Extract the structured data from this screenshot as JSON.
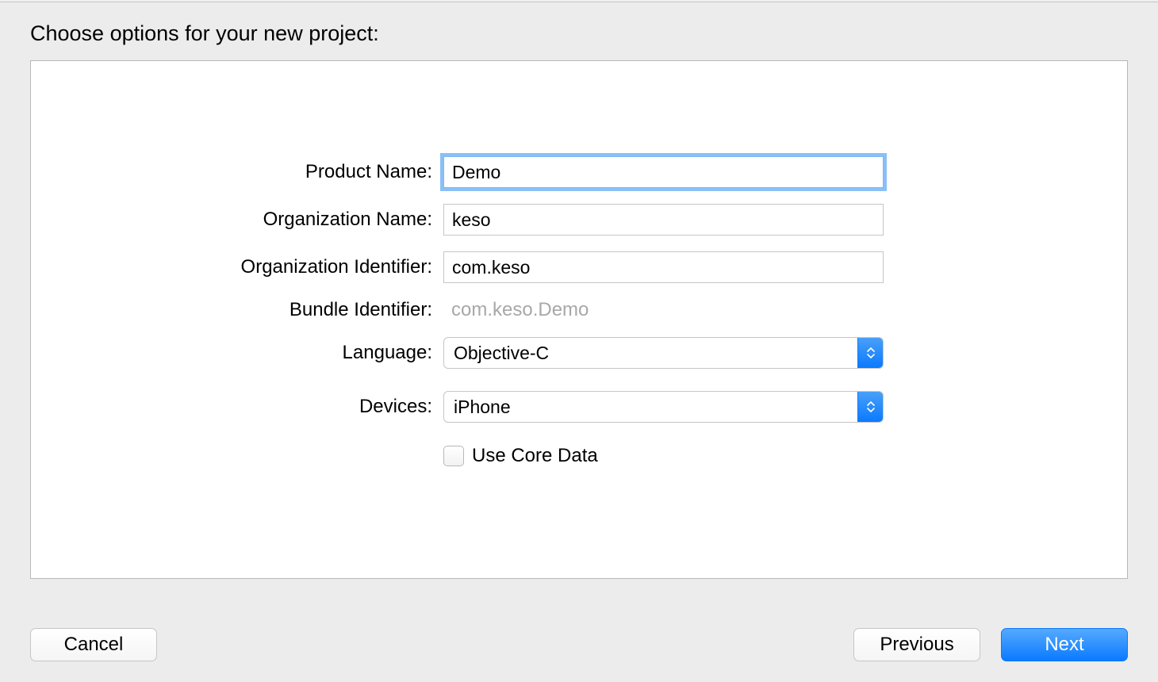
{
  "heading": "Choose options for your new project:",
  "form": {
    "productName": {
      "label": "Product Name:",
      "value": "Demo"
    },
    "organizationName": {
      "label": "Organization Name:",
      "value": "keso"
    },
    "organizationIdentifier": {
      "label": "Organization Identifier:",
      "value": "com.keso"
    },
    "bundleIdentifier": {
      "label": "Bundle Identifier:",
      "value": "com.keso.Demo"
    },
    "language": {
      "label": "Language:",
      "value": "Objective-C"
    },
    "devices": {
      "label": "Devices:",
      "value": "iPhone"
    },
    "useCoreData": {
      "label": "Use Core Data",
      "checked": false
    }
  },
  "buttons": {
    "cancel": "Cancel",
    "previous": "Previous",
    "next": "Next"
  }
}
